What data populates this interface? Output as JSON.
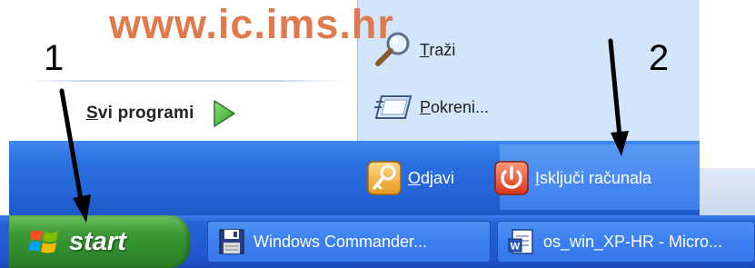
{
  "watermark": "www.ic.ims.hr",
  "annotations": {
    "one": "1",
    "two": "2"
  },
  "start_menu": {
    "all_programs": {
      "label": "Svi programi",
      "mnemonic": "S",
      "rest": "vi programi",
      "icon": "green-arrow-icon"
    },
    "right_items": [
      {
        "label": "Traži",
        "mnemonic": "T",
        "rest": "raži",
        "icon": "search-icon"
      },
      {
        "label": "Pokreni...",
        "mnemonic": "P",
        "rest": "okreni...",
        "icon": "run-icon"
      }
    ],
    "logoff": {
      "label": "Odjavi",
      "mnemonic": "O",
      "rest": "djavi",
      "icon": "key-icon"
    },
    "shutdown": {
      "label": "Isključi računala",
      "mnemonic": "I",
      "rest": "sključi računala",
      "icon": "power-icon"
    }
  },
  "taskbar": {
    "start_label": "start",
    "tasks": [
      {
        "label": "Windows Commander...",
        "icon": "floppy-disk-icon"
      },
      {
        "label": "os_win_XP-HR - Micro...",
        "icon": "word-document-icon"
      }
    ]
  },
  "colors": {
    "menu_blue": "#2464d8",
    "right_pane": "#d3e5fa",
    "start_green": "#3b9a36",
    "watermark": "#e07a4c"
  }
}
